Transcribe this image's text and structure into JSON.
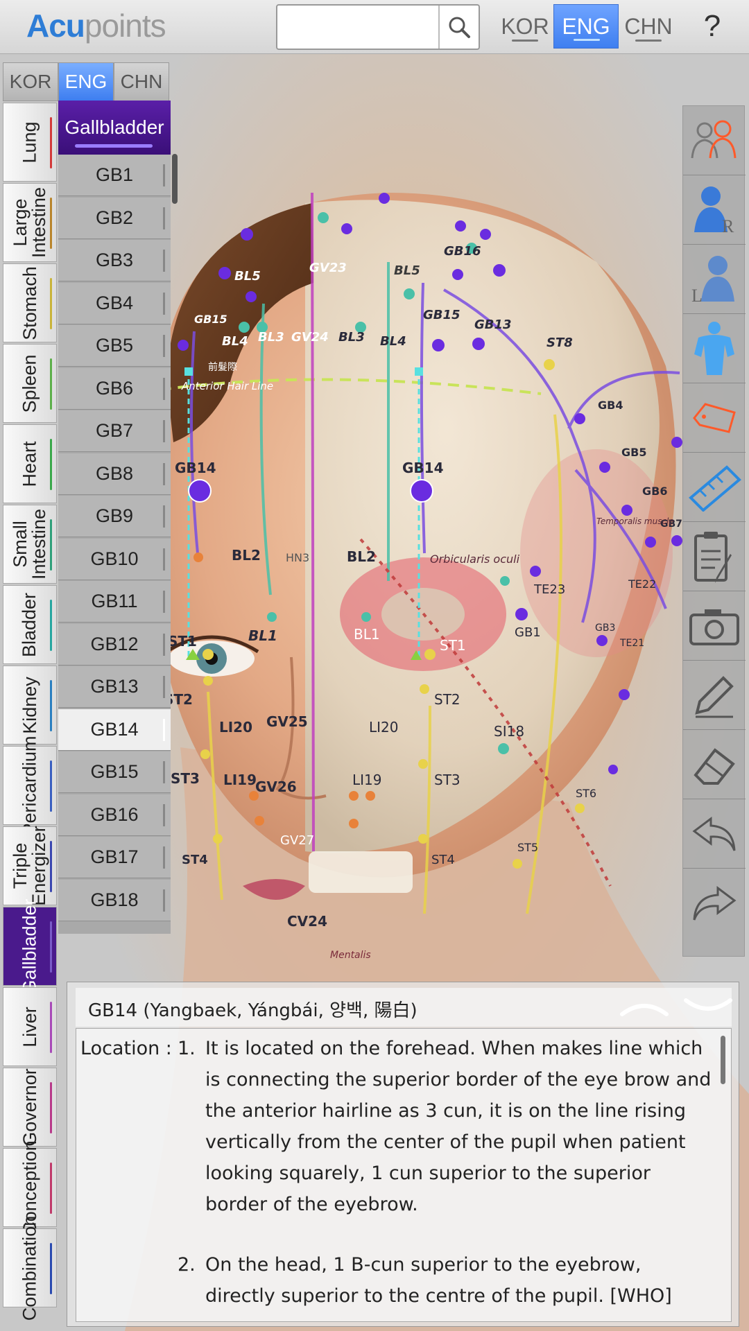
{
  "app": {
    "logo_acu": "Acu",
    "logo_points": "points"
  },
  "search": {
    "placeholder": "",
    "value": ""
  },
  "top_lang": {
    "kor": "KOR",
    "eng": "ENG",
    "chn": "CHN",
    "active": "ENG"
  },
  "help": "?",
  "meridian_lang": {
    "kor": "KOR",
    "eng": "ENG",
    "chn": "CHN",
    "active": "ENG"
  },
  "meridians": [
    {
      "label": "Lung",
      "color": "#d33a3a"
    },
    {
      "label": "Large\nIntestine",
      "color": "#b9852c"
    },
    {
      "label": "Stomach",
      "color": "#c9b43a"
    },
    {
      "label": "Spleen",
      "color": "#5db04a"
    },
    {
      "label": "Heart",
      "color": "#3aa84a"
    },
    {
      "label": "Small\nIntestine",
      "color": "#2fa07a"
    },
    {
      "label": "Bladder",
      "color": "#27a6a0"
    },
    {
      "label": "Kidney",
      "color": "#2a7fc0"
    },
    {
      "label": "Pericardium",
      "color": "#3a5fc0"
    },
    {
      "label": "Triple\nEnergizer",
      "color": "#3a46b0"
    },
    {
      "label": "Gallbladder",
      "color": "#7a5ac8",
      "active": true
    },
    {
      "label": "Liver",
      "color": "#a84ab8"
    },
    {
      "label": "Governor",
      "color": "#b83a8a"
    },
    {
      "label": "Conception",
      "color": "#c03a6a"
    },
    {
      "label": "Combination",
      "color": "#2a4ab0"
    }
  ],
  "point_list": {
    "header": "Gallbladder",
    "items": [
      "GB1",
      "GB2",
      "GB3",
      "GB4",
      "GB5",
      "GB6",
      "GB7",
      "GB8",
      "GB9",
      "GB10",
      "GB11",
      "GB12",
      "GB13",
      "GB14",
      "GB15",
      "GB16",
      "GB17",
      "GB18"
    ],
    "selected": "GB14"
  },
  "figure_labels": {
    "gb14_left": "GB14",
    "gb14_right": "GB14",
    "bl5_left": "BL5",
    "gv23": "GV23",
    "bl5_right": "BL5",
    "gb16": "GB16",
    "gb15_left": "GB15",
    "gb15_right": "GB15",
    "gb13": "GB13",
    "st8": "ST8",
    "bl4_left": "BL4",
    "bl3_left": "BL3",
    "gv24": "GV24",
    "bl3_right": "BL3",
    "bl4_right": "BL4",
    "gb4": "GB4",
    "gb5": "GB5",
    "gb6": "GB6",
    "gb7": "GB7",
    "hairline_cn": "前髮際",
    "hairline_en": "Anterior Hair Line",
    "bl2_left": "BL2",
    "hn3": "HN3",
    "bl2_right": "BL2",
    "orbicularis": "Orbicularis oculi",
    "te23": "TE23",
    "te22": "TE22",
    "gb3": "GB3",
    "gb1": "GB1",
    "te21": "TE21",
    "st1_left": "ST1",
    "bl1_left": "BL1",
    "st1_right": "ST1",
    "bl1_right": "BL1",
    "st2_left": "ST2",
    "st2_right": "ST2",
    "li20_left": "LI20",
    "gv25": "GV25",
    "li20_right": "LI20",
    "si18": "SI18",
    "st3_left": "ST3",
    "li19_left": "LI19",
    "gv26": "GV26",
    "li19_right": "LI19",
    "st3_right": "ST3",
    "st6": "ST6",
    "st4_left": "ST4",
    "gv27": "GV27",
    "st4_right": "ST4",
    "st5": "ST5",
    "cv24": "CV24",
    "mentalis": "Mentalis",
    "temporalis": "Temporalis muscle"
  },
  "info": {
    "title": "GB14 (Yangbaek, Yángbái, 양백, 陽白)",
    "location_label": "Location : ",
    "items": [
      {
        "num": "1.",
        "text": "It is located on the forehead. When makes line which is connecting the superior border of the eye brow and the anterior hairline as 3 cun, it is on the line rising vertically from the center of the pupil when patient looking squarely, 1 cun superior to the superior border of the eyebrow."
      },
      {
        "num": "2.",
        "text": "On the head, 1 B-cun superior to the eyebrow, directly superior to the centre of the pupil. [WHO]"
      }
    ]
  },
  "toolbar": [
    "gender-toggle-icon",
    "right-side-icon",
    "left-side-icon",
    "muscle-icon",
    "name-tag-icon",
    "ruler-icon",
    "clipboard-icon",
    "camera-icon",
    "pencil-icon",
    "eraser-icon",
    "undo-icon",
    "redo-icon"
  ],
  "colors": {
    "accent": "#3f7ff0",
    "gallbladder": "#4a1a8c",
    "point": "#6a2ce0",
    "meridian_gb": "#7a5ac8"
  }
}
